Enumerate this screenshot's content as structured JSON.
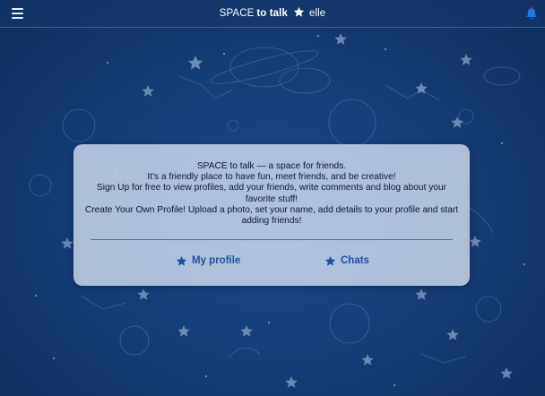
{
  "header": {
    "brand_part1": "SPACE",
    "brand_part2": "to talk",
    "username": "elle",
    "menu_icon": "hamburger-menu-icon",
    "notification_icon": "bell-icon",
    "accent_color": "#1e78d8"
  },
  "card": {
    "lines": [
      "SPACE to talk — a space for friends.",
      "It's a friendly place to have fun, meet friends, and be creative!",
      "Sign Up for free to view profiles, add your friends, write comments and blog about your favorite stuff!",
      "Create Your Own Profile! Upload a photo, set your name, add details to your profile and start adding friends!"
    ],
    "links": [
      {
        "label": "My profile",
        "icon": "star-icon"
      },
      {
        "label": "Chats",
        "icon": "star-icon"
      }
    ]
  },
  "theme": {
    "background": "#163f7c",
    "link_color": "#1f4f9e",
    "card_bg": "#d5e0f0"
  }
}
